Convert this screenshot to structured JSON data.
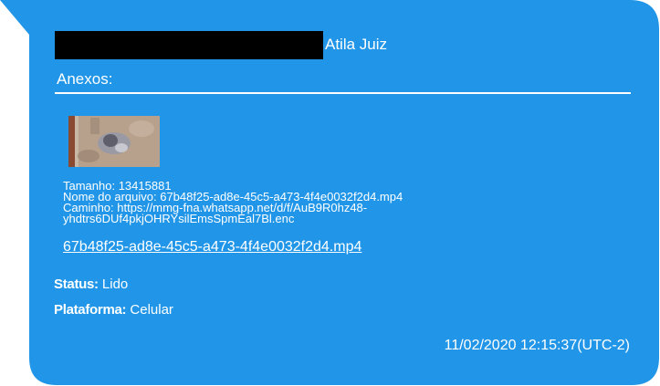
{
  "message": {
    "sender_name": "Atila Juiz",
    "attachments_heading": "Anexos:",
    "attachment": {
      "size_line": "Tamanho: 13415881",
      "filename_line": "Nome do arquivo: 67b48f25-ad8e-45c5-a473-4f4e0032f2d4.mp4",
      "path_line_1": "Caminho: https://mmg-fna.whatsapp.net/d/f/AuB9R0hz48-",
      "path_line_2": "yhdtrs6DUf4pkjOHRYsilEmsSpmEal7Bl.enc",
      "link_text": "67b48f25-ad8e-45c5-a473-4f4e0032f2d4.mp4"
    },
    "status_label": "Status:",
    "status_value": " Lido",
    "platform_label": "Plataforma:",
    "platform_value": " Celular",
    "timestamp": "11/02/2020 12:15:37(UTC-2)"
  },
  "colors": {
    "bubble": "#2196e8",
    "text": "#ffffff",
    "redaction": "#000000"
  }
}
